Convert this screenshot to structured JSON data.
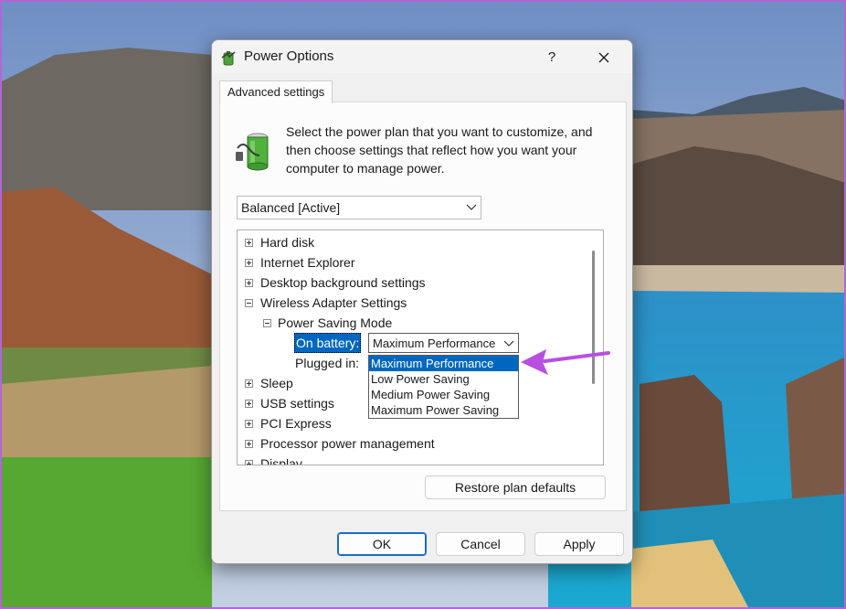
{
  "window": {
    "title": "Power Options",
    "help_label": "?",
    "tab_label": "Advanced settings"
  },
  "intro_text": "Select the power plan that you want to customize, and then choose settings that reflect how you want your computer to manage power.",
  "plan_select": {
    "value": "Balanced [Active]"
  },
  "tree": {
    "items_top": [
      "Hard disk",
      "Internet Explorer",
      "Desktop background settings"
    ],
    "expanded": "Wireless Adapter Settings",
    "subgroup": "Power Saving Mode",
    "on_battery_label": "On battery:",
    "on_battery_value": "Maximum Performance",
    "plugged_in_label": "Plugged in:",
    "dropdown_options": [
      "Maximum Performance",
      "Low Power Saving",
      "Medium Power Saving",
      "Maximum Power Saving"
    ],
    "items_bottom": [
      "Sleep",
      "USB settings",
      "PCI Express",
      "Processor power management",
      "Display"
    ]
  },
  "buttons": {
    "restore": "Restore plan defaults",
    "ok": "OK",
    "cancel": "Cancel",
    "apply": "Apply"
  },
  "colors": {
    "selection": "#0067c0",
    "annotation_arrow": "#b94fe0"
  }
}
